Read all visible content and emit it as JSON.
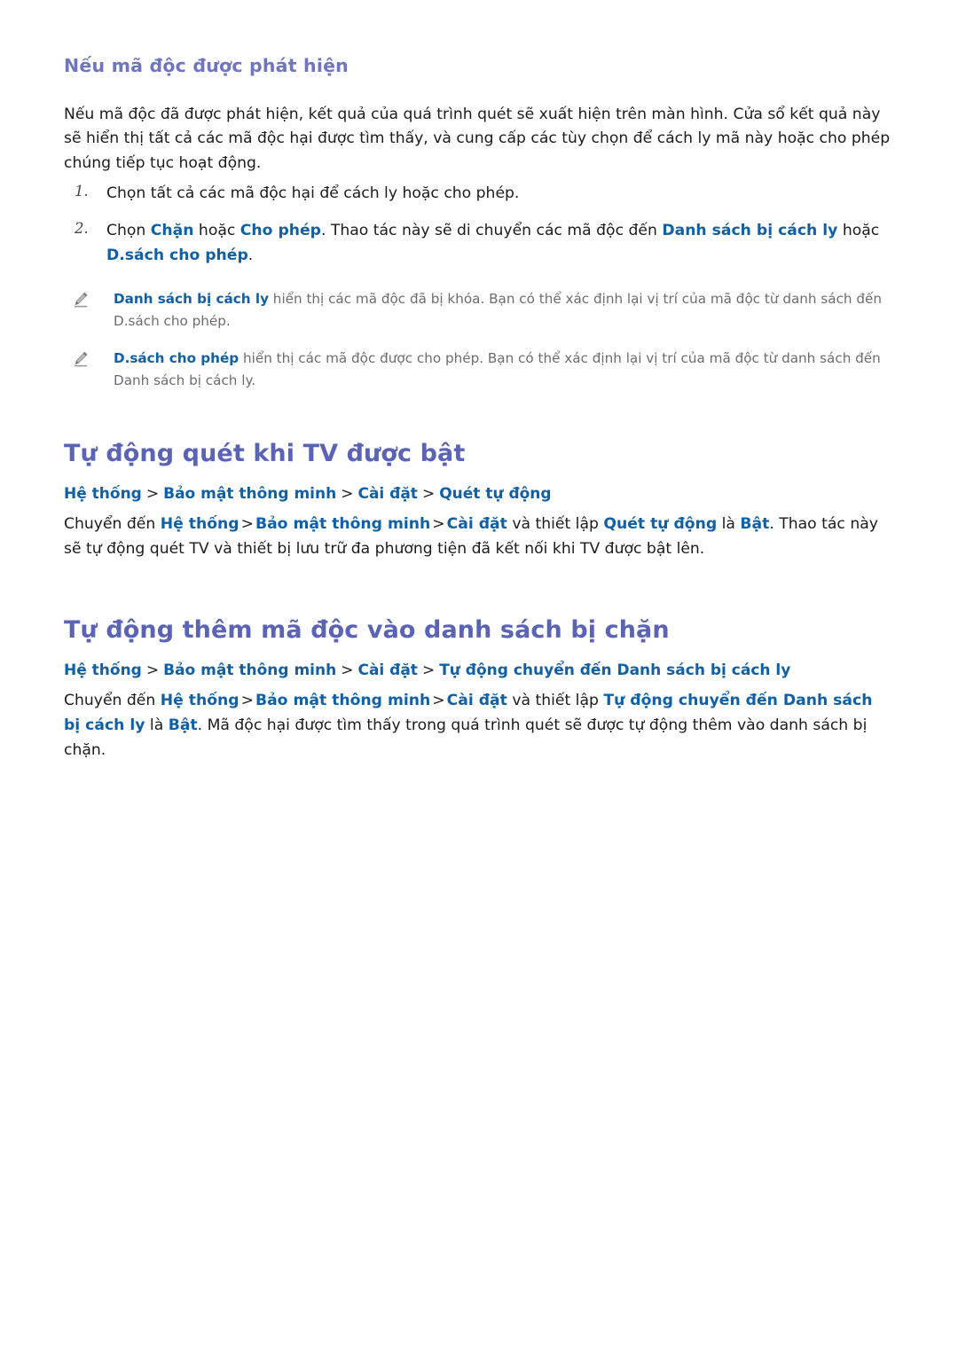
{
  "page": {
    "language": "vi",
    "colors": {
      "heading_main": "#5a63b4",
      "heading_sub": "#6f76bd",
      "keyword_blue": "#1060a8",
      "body_text": "#1c1c1c",
      "note_text": "#6d6d6d",
      "background": "#ffffff"
    }
  },
  "section_detected": {
    "heading": "Nếu mã độc được phát hiện",
    "intro": "Nếu mã độc đã được phát hiện, kết quả của quá trình quét sẽ xuất hiện trên màn hình. Cửa sổ kết quả này sẽ hiển thị tất cả các mã độc hại được tìm thấy, và cung cấp các tùy chọn để cách ly mã này hoặc cho phép chúng tiếp tục hoạt động.",
    "steps": [
      {
        "number": "1.",
        "parts": [
          {
            "t": "Chọn tất cả các mã độc hại để cách ly hoặc cho phép.",
            "style": "plain"
          }
        ]
      },
      {
        "number": "2.",
        "parts": [
          {
            "t": "Chọn ",
            "style": "plain"
          },
          {
            "t": "Chặn",
            "style": "kw"
          },
          {
            "t": " hoặc ",
            "style": "plain"
          },
          {
            "t": "Cho phép",
            "style": "kw"
          },
          {
            "t": ". Thao tác này sẽ di chuyển các mã độc đến ",
            "style": "plain"
          },
          {
            "t": "Danh sách bị cách ly",
            "style": "kw"
          },
          {
            "t": " hoặc ",
            "style": "plain"
          },
          {
            "t": "D.sách cho phép",
            "style": "kw"
          },
          {
            "t": ".",
            "style": "plain"
          }
        ]
      }
    ],
    "notes": [
      {
        "icon": "pencil-icon",
        "parts": [
          {
            "t": "Danh sách bị cách ly",
            "style": "kw"
          },
          {
            "t": " hiển thị các mã độc đã bị khóa. Bạn có thể xác định lại vị trí của mã độc từ danh sách đến D.sách cho phép.",
            "style": "plain"
          }
        ]
      },
      {
        "icon": "pencil-icon",
        "parts": [
          {
            "t": "D.sách cho phép",
            "style": "kw"
          },
          {
            "t": " hiển thị các mã độc được cho phép. Bạn có thể xác định lại vị trí của mã độc từ danh sách đến Danh sách bị cách ly.",
            "style": "plain"
          }
        ]
      }
    ]
  },
  "section_autoscan": {
    "heading": "Tự động quét khi TV được bật",
    "breadcrumb": [
      "Hệ thống",
      "Bảo mật thông minh",
      "Cài đặt",
      "Quét tự động"
    ],
    "breadcrumb_separator": ">",
    "body_parts": [
      {
        "t": "Chuyển đến ",
        "style": "plain"
      },
      {
        "t": "Hệ thống",
        "style": "kw"
      },
      {
        "t": ">",
        "style": "sep"
      },
      {
        "t": "Bảo mật thông minh",
        "style": "kw"
      },
      {
        "t": ">",
        "style": "sep"
      },
      {
        "t": "Cài đặt",
        "style": "kw"
      },
      {
        "t": " và thiết lập ",
        "style": "plain"
      },
      {
        "t": "Quét tự động",
        "style": "kw"
      },
      {
        "t": " là ",
        "style": "plain"
      },
      {
        "t": "Bật",
        "style": "kw"
      },
      {
        "t": ". Thao tác này sẽ tự động quét TV và thiết bị lưu trữ đa phương tiện đã kết nối khi TV được bật lên.",
        "style": "plain"
      }
    ]
  },
  "section_autoblock": {
    "heading": "Tự động thêm mã độc vào danh sách bị chặn",
    "breadcrumb": [
      "Hệ thống",
      "Bảo mật thông minh",
      "Cài đặt",
      "Tự động chuyển đến Danh sách bị cách ly"
    ],
    "breadcrumb_separator": ">",
    "body_parts": [
      {
        "t": "Chuyển đến ",
        "style": "plain"
      },
      {
        "t": "Hệ thống",
        "style": "kw"
      },
      {
        "t": ">",
        "style": "sep"
      },
      {
        "t": "Bảo mật thông minh",
        "style": "kw"
      },
      {
        "t": ">",
        "style": "sep"
      },
      {
        "t": "Cài đặt",
        "style": "kw"
      },
      {
        "t": " và thiết lập ",
        "style": "plain"
      },
      {
        "t": "Tự động chuyển đến Danh sách bị cách ly",
        "style": "kw"
      },
      {
        "t": " là ",
        "style": "plain"
      },
      {
        "t": "Bật",
        "style": "kw"
      },
      {
        "t": ". Mã độc hại được tìm thấy trong quá trình quét sẽ được tự động thêm vào danh sách bị chặn.",
        "style": "plain"
      }
    ]
  }
}
